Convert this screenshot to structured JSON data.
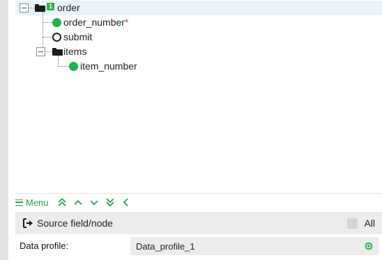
{
  "tree": {
    "nodes": [
      {
        "label": "order",
        "badge": "1",
        "type": "folder"
      },
      {
        "label": "order_number",
        "required_mark": "*",
        "type": "field-filled"
      },
      {
        "label": "submit",
        "type": "field-empty"
      },
      {
        "label": "items",
        "type": "folder"
      },
      {
        "label": "item_number",
        "type": "field-filled"
      }
    ]
  },
  "toolbar": {
    "menu_label": "Menu",
    "icons": [
      "double-chevron-up-icon",
      "chevron-up-icon",
      "chevron-down-icon",
      "double-chevron-down-icon",
      "chevron-left-icon"
    ]
  },
  "source": {
    "button_label": "Source field/node",
    "all_label": "All"
  },
  "profile": {
    "label": "Data profile:",
    "value": "Data_profile_1"
  },
  "colors": {
    "accent_green": "#2e9b4d",
    "node_green": "#22b14c",
    "required_red": "#e53935",
    "selected_row": "#e9f4fa"
  }
}
